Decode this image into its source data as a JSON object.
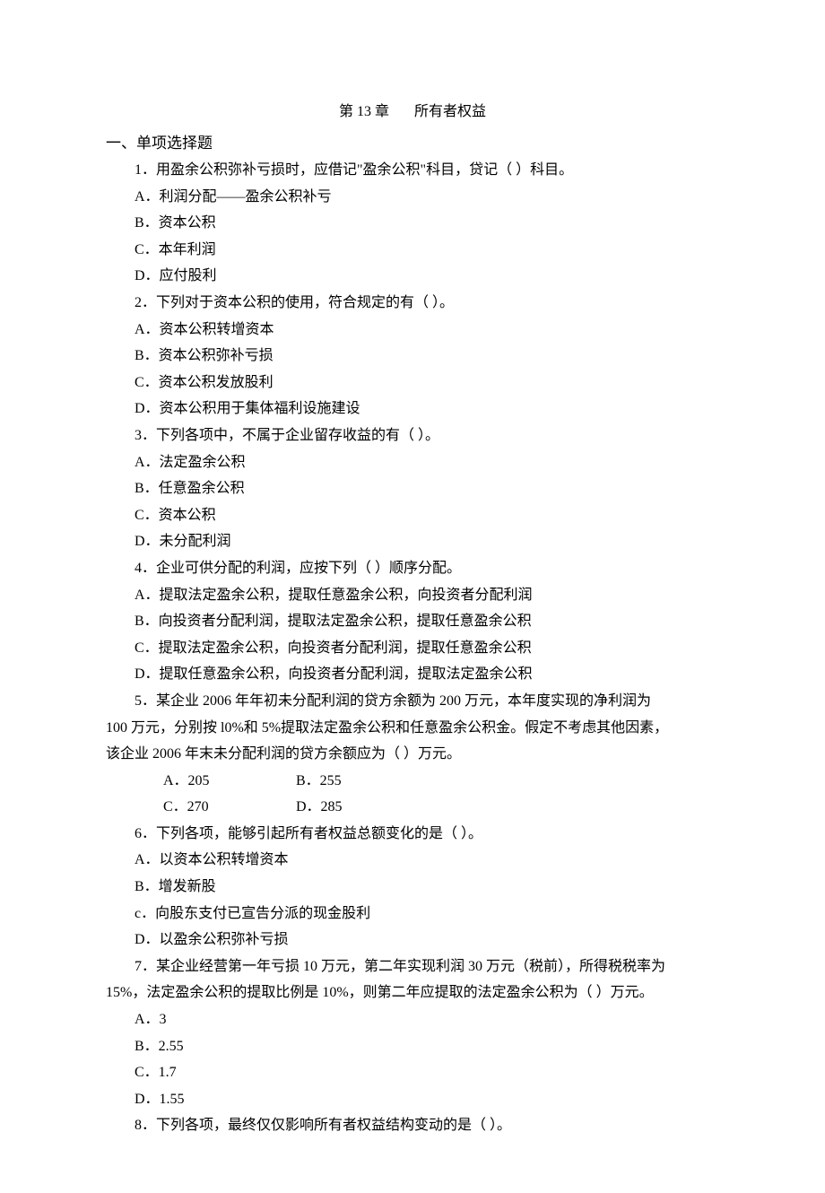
{
  "chapter": {
    "label": "第 13 章",
    "title": "所有者权益"
  },
  "section_header": "一、单项选择题",
  "q1": {
    "stem": "1．用盈余公积弥补亏损时，应借记\"盈余公积\"科目，贷记（    ）科目。",
    "a": "A．利润分配——盈余公积补亏",
    "b": "B．资本公积",
    "c": "C．本年利润",
    "d": "D．应付股利"
  },
  "q2": {
    "stem": "2．下列对于资本公积的使用，符合规定的有（    ）。",
    "a": "A．资本公积转增资本",
    "b": "B．资本公积弥补亏损",
    "c": "C．资本公积发放股利",
    "d": "D．资本公积用于集体福利设施建设"
  },
  "q3": {
    "stem": "3．下列各项中，不属于企业留存收益的有（  ）。",
    "a": "A．法定盈余公积",
    "b": "B．任意盈余公积",
    "c": "C．资本公积",
    "d": "D．未分配利润"
  },
  "q4": {
    "stem": "4．企业可供分配的利润，应按下列（   ）顺序分配。",
    "a": "A．提取法定盈余公积，提取任意盈余公积，向投资者分配利润",
    "b": "B．向投资者分配利润，提取法定盈余公积，提取任意盈余公积",
    "c": "C．提取法定盈余公积，向投资者分配利润，提取任意盈余公积",
    "d": "D．提取任意盈余公积，向投资者分配利润，提取法定盈余公积"
  },
  "q5": {
    "stem1": "5．某企业 2006 年年初未分配利润的贷方余额为 200 万元，本年度实现的净利润为",
    "stem2": "100 万元，分别按 l0%和 5%提取法定盈余公积和任意盈余公积金。假定不考虑其他因素，",
    "stem3": "该企业 2006 年末未分配利润的贷方余额应为（    ）万元。",
    "a": "A．205",
    "b": "B．255",
    "c": "C．270",
    "d": "D．285"
  },
  "q6": {
    "stem": "6．下列各项，能够引起所有者权益总额变化的是（    ）。",
    "a": "A．以资本公积转增资本",
    "b": "B．增发新股",
    "c": "c．向股东支付已宣告分派的现金股利",
    "d": "D．以盈余公积弥补亏损"
  },
  "q7": {
    "stem1": "7．某企业经营第一年亏损 10 万元，第二年实现利润 30 万元（税前），所得税税率为",
    "stem2": "15%，法定盈余公积的提取比例是 10%，则第二年应提取的法定盈余公积为（  ）万元。",
    "a": "A．3",
    "b": "B．2.55",
    "c": "C．1.7",
    "d": "D．1.55"
  },
  "q8": {
    "stem": "8．下列各项，最终仅仅影响所有者权益结构变动的是（   ）。"
  }
}
